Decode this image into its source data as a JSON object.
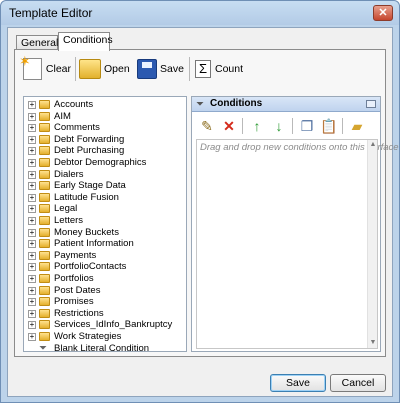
{
  "window": {
    "title": "Template Editor"
  },
  "tabs": [
    {
      "label": "General"
    },
    {
      "label": "Conditions"
    }
  ],
  "toolbar": {
    "clear": "Clear",
    "open": "Open",
    "save": "Save",
    "count": "Count"
  },
  "tree": {
    "items": [
      "Accounts",
      "AIM",
      "Comments",
      "Debt Forwarding",
      "Debt Purchasing",
      "Debtor Demographics",
      "Dialers",
      "Early Stage Data",
      "Latitude Fusion",
      "Legal",
      "Letters",
      "Money Buckets",
      "Patient Information",
      "Payments",
      "PortfolioContacts",
      "Portfolios",
      "Post Dates",
      "Promises",
      "Restrictions",
      "Services_IdInfo_Bankruptcy",
      "Work Strategies"
    ],
    "literal": "Blank Literal Condition"
  },
  "conditions": {
    "title": "Conditions",
    "hint": "Drag and drop new conditions onto this surface"
  },
  "dialog": {
    "save": "Save",
    "cancel": "Cancel"
  },
  "icons": {
    "close": "close-icon",
    "clear": "clear-icon",
    "open": "folder-open-icon",
    "save": "floppy-disk-icon",
    "count": "sigma-icon",
    "folder": "folder-icon",
    "literal": "funnel-icon"
  }
}
